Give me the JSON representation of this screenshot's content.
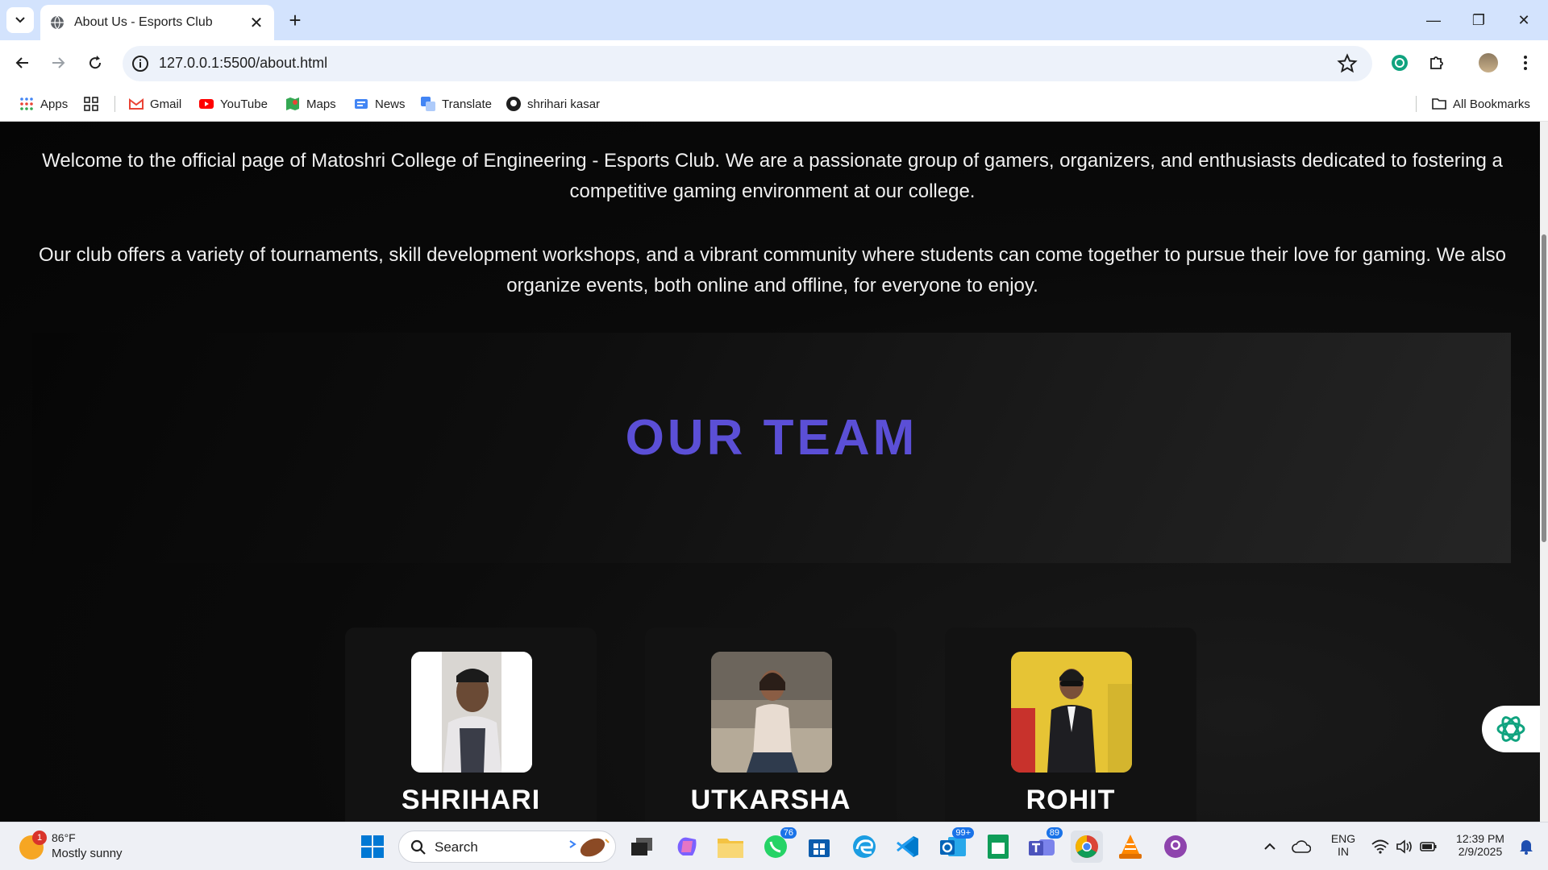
{
  "browser": {
    "tab_title": "About Us - Esports Club",
    "url": "127.0.0.1:5500/about.html",
    "bookmarks": [
      "Apps",
      "Gmail",
      "YouTube",
      "Maps",
      "News",
      "Translate",
      "shrihari kasar"
    ],
    "all_bookmarks": "All Bookmarks"
  },
  "page": {
    "intro_paragraph_1": "Welcome to the official page of Matoshri College of Engineering - Esports Club. We are a passionate group of gamers, organizers, and enthusiasts dedicated to fostering a competitive gaming environment at our college.",
    "intro_paragraph_2": "Our club offers a variety of tournaments, skill development workshops, and a vibrant community where students can come together to pursue their love for gaming. We also organize events, both online and offline, for everyone to enjoy.",
    "team_title": "OUR TEAM",
    "members": [
      {
        "name": "SHRIHARI"
      },
      {
        "name": "UTKARSHA"
      },
      {
        "name": "ROHIT"
      }
    ],
    "accent_color": "#5b4fd6"
  },
  "taskbar": {
    "weather_badge": "1",
    "temperature": "86°F",
    "condition": "Mostly sunny",
    "search_label": "Search",
    "badges": {
      "whatsapp": "76",
      "outlook": "99+",
      "teams": "89"
    },
    "language": "ENG",
    "region": "IN",
    "time": "12:39 PM",
    "date": "2/9/2025"
  }
}
